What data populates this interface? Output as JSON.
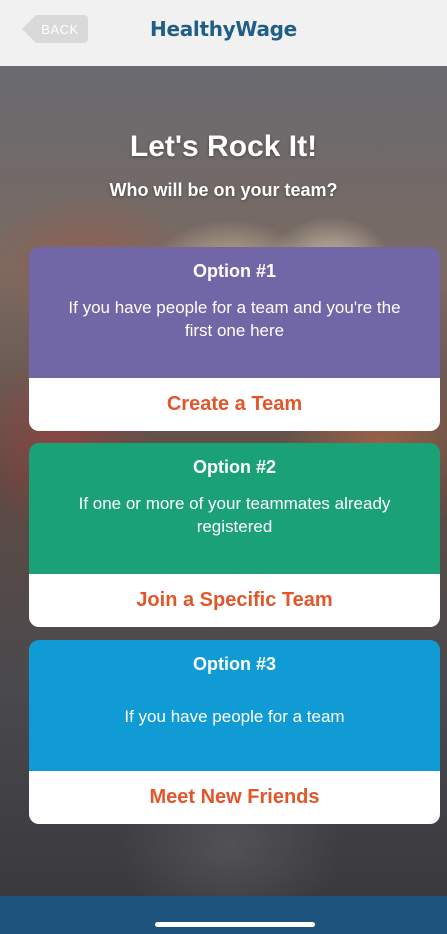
{
  "navbar": {
    "back_label": "BACK",
    "logo_text": "HealthyWage"
  },
  "header": {
    "title": "Let's Rock It!",
    "subtitle": "Who will be on your team?"
  },
  "options": [
    {
      "heading": "Option #1",
      "description": "If you have people for a team and you're the first one here",
      "action": "Create a Team",
      "color": "#7166a6"
    },
    {
      "heading": "Option #2",
      "description": "If one or more of your teammates already registered",
      "action": "Join a Specific Team",
      "color": "#1aa276"
    },
    {
      "heading": "Option #3",
      "description": "If you have people for a team",
      "action": "Meet New Friends",
      "color": "#109bd5"
    }
  ],
  "colors": {
    "action_text": "#e3562a",
    "logo": "#1f5e87",
    "bottom_bar": "#1c527c"
  }
}
